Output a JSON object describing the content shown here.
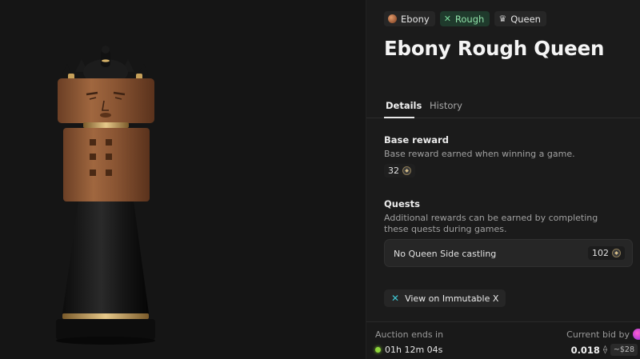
{
  "tags": [
    {
      "label": "Ebony",
      "icon": "ebony-swatch-icon"
    },
    {
      "label": "Rough",
      "icon": "rough-texture-icon"
    },
    {
      "label": "Queen",
      "icon": "crown-icon"
    }
  ],
  "title": "Ebony Rough Queen",
  "tabs": {
    "details": "Details",
    "history": "History",
    "active": "details"
  },
  "base_reward": {
    "title": "Base reward",
    "description": "Base reward earned when winning a game.",
    "value": "32",
    "icon": "token-coin-icon"
  },
  "quests": {
    "title": "Quests",
    "description": "Additional rewards can be earned by completing these quests during games.",
    "items": [
      {
        "label": "No Queen Side castling",
        "reward": "102",
        "icon": "token-coin-icon"
      }
    ]
  },
  "link": {
    "label": "View on Immutable X",
    "icon": "immutable-x-icon"
  },
  "auction": {
    "ends_label": "Auction ends in",
    "time_left": "01h 12m 04s",
    "bid_label": "Current bid by",
    "bid_eth": "0.018",
    "bid_usd": "~$28",
    "status_color": "#8ed63a"
  },
  "colors": {
    "rough_tag_bg": "#1f3a2c",
    "rough_tag_text": "#8fe0a8",
    "immutable_accent": "#3fc8d4"
  }
}
